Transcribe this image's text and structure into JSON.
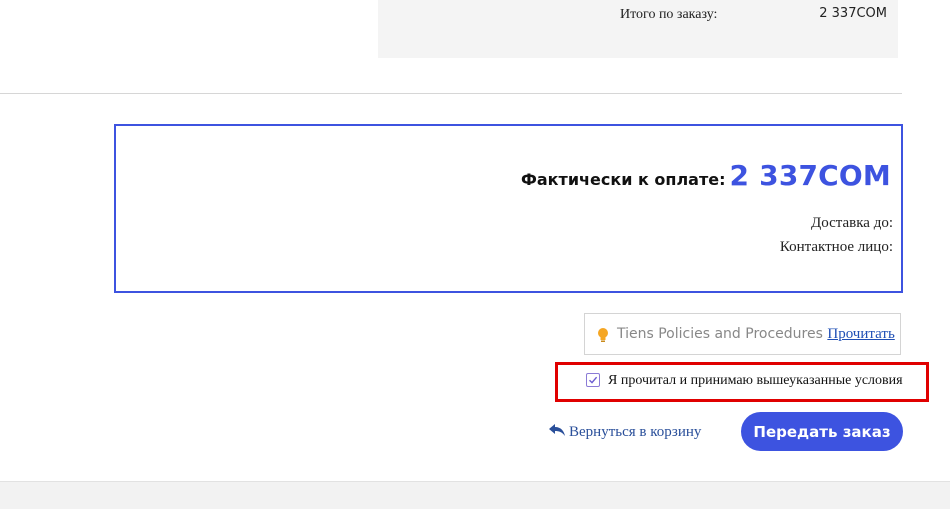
{
  "order_summary": {
    "total_label": "Итого по заказу:",
    "total_value": "2 337COM"
  },
  "payment": {
    "label": "Фактически к оплате:",
    "amount": "2 337COM",
    "delivery_label": "Доставка до:",
    "contact_label": "Контактное лицо:"
  },
  "policy": {
    "icon": "lightbulb-icon",
    "text": "Tiens Policies and Procedures",
    "link_label": "Прочитать"
  },
  "agreement": {
    "checked": true,
    "label": "Я прочитал и принимаю вышеуказанные условия"
  },
  "actions": {
    "back_icon": "reply-arrow-icon",
    "back_label": "Вернуться в корзину",
    "submit_label": "Передать заказ"
  },
  "colors": {
    "accent": "#3d53e0",
    "highlight_border": "#e00000",
    "bulb": "#f5a623"
  }
}
